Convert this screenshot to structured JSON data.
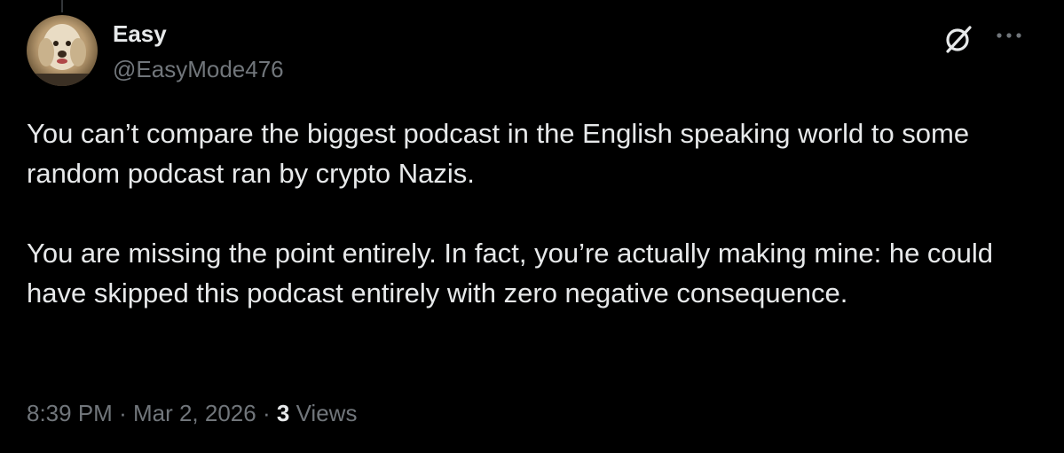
{
  "tweet": {
    "author": {
      "display_name": "Easy",
      "handle": "@EasyMode476",
      "avatar": "dog-avatar"
    },
    "body": [
      "You can’t compare the biggest podcast in the English speaking world to some random podcast ran by crypto Nazis.",
      "You are missing the point entirely. In fact, you’re actually making mine: he could have skipped this podcast entirely with zero negative consequence."
    ],
    "time": "8:39 PM",
    "separator": "·",
    "date": "Mar 2, 2026",
    "views_count": "3",
    "views_label": "Views",
    "icons": {
      "grok": "grok-icon",
      "more": "more-options-icon"
    }
  },
  "colors": {
    "background": "#000000",
    "primary_text": "#e7e9ea",
    "secondary_text": "#71767b"
  }
}
